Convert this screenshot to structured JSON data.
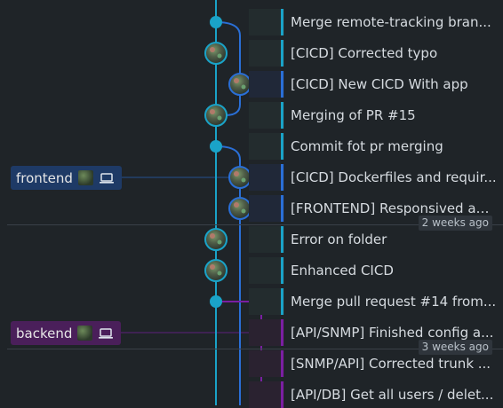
{
  "colors": {
    "background": "#1f2428",
    "main_lane": "#1aa3c8",
    "frontend_lane": "#2a6fd6",
    "backend_lane": "#7a1fa2",
    "frontend_tag_bg": "#1e3a66",
    "backend_tag_bg": "#4a1f5a",
    "separator": "#3a4048"
  },
  "commits": [
    {
      "message": "Merge remote-tracking bran...",
      "lane": "main",
      "node": "dot"
    },
    {
      "message": "[CICD] Corrected typo",
      "lane": "main",
      "node": "avatar"
    },
    {
      "message": "[CICD] New CICD With app",
      "lane": "frontend",
      "node": "avatar"
    },
    {
      "message": "Merging of PR #15",
      "lane": "main",
      "node": "avatar"
    },
    {
      "message": "Commit fot pr merging",
      "lane": "main",
      "node": "dot"
    },
    {
      "message": "[CICD] Dockerfiles and requir...",
      "lane": "frontend",
      "node": "avatar"
    },
    {
      "message": "[FRONTEND] Responsived ap...",
      "lane": "frontend",
      "node": "avatar"
    },
    {
      "message": "Error on folder",
      "lane": "main",
      "node": "avatar"
    },
    {
      "message": "Enhanced CICD",
      "lane": "main",
      "node": "avatar"
    },
    {
      "message": "Merge pull request #14 from...",
      "lane": "main",
      "node": "dot"
    },
    {
      "message": "[API/SNMP] Finished config a...",
      "lane": "backend",
      "node": "avatar"
    },
    {
      "message": "[SNMP/API] Corrected trunk ...",
      "lane": "backend",
      "node": "avatar"
    },
    {
      "message": "[API/DB] Get all users / delet...",
      "lane": "backend",
      "node": "avatar"
    }
  ],
  "time_labels": [
    "2 weeks ago",
    "3 weeks ago"
  ],
  "branches": [
    {
      "name": "frontend",
      "avatar_icon": "avatar-icon",
      "device_icon": "laptop-icon"
    },
    {
      "name": "backend",
      "avatar_icon": "avatar-icon",
      "device_icon": "laptop-icon"
    }
  ]
}
